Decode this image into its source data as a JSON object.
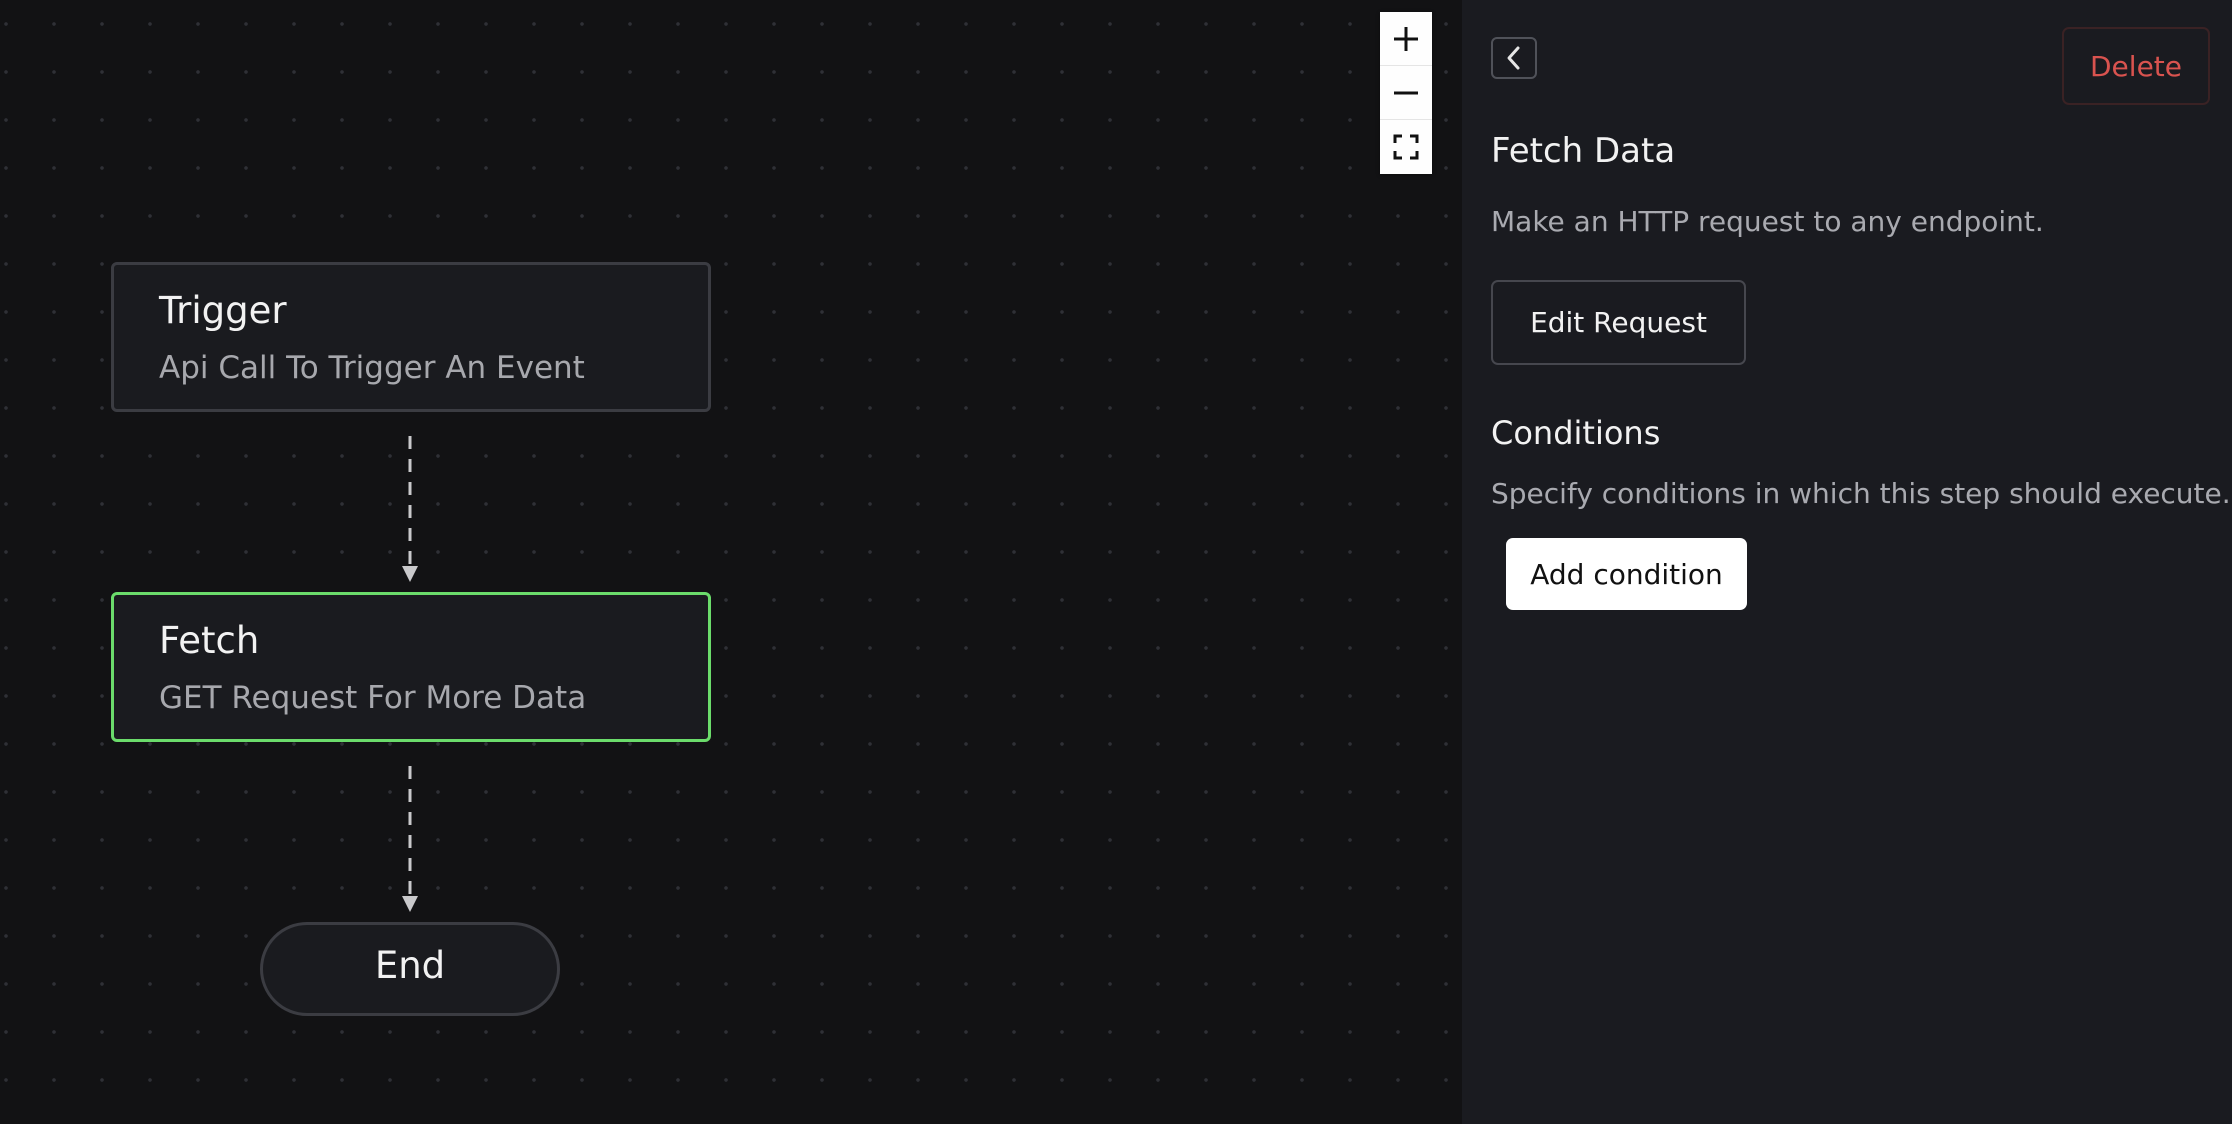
{
  "canvas": {
    "nodes": {
      "trigger": {
        "title": "Trigger",
        "subtitle": "Api Call To Trigger An Event"
      },
      "fetch": {
        "title": "Fetch",
        "subtitle": "GET Request For More Data",
        "selected": true
      },
      "end": {
        "label": "End"
      }
    },
    "zoom_controls": {
      "zoom_in_icon": "plus-icon",
      "zoom_out_icon": "minus-icon",
      "fit_view_icon": "fit-view-icon"
    },
    "colors": {
      "selected_border": "#6bdc6b",
      "background": "#121214"
    }
  },
  "panel": {
    "back_icon": "chevron-left-icon",
    "delete_label": "Delete",
    "title": "Fetch Data",
    "description": "Make an HTTP request to any endpoint.",
    "edit_request_label": "Edit Request",
    "conditions": {
      "title": "Conditions",
      "description": "Specify conditions in which this step should execute.",
      "add_condition_label": "Add condition"
    },
    "colors": {
      "delete": "#d9534f",
      "background": "#1a1b20"
    }
  }
}
